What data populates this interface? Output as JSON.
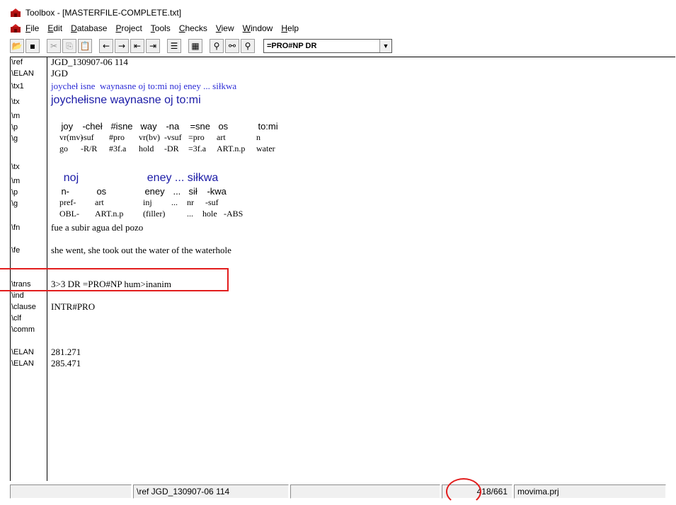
{
  "window": {
    "title": "Toolbox - [MASTERFILE-COMPLETE.txt]",
    "icon": "toolbox-app-icon"
  },
  "menu": [
    "File",
    "Edit",
    "Database",
    "Project",
    "Tools",
    "Checks",
    "View",
    "Window",
    "Help"
  ],
  "toolbar": {
    "buttons": [
      "open-icon",
      "save-icon",
      "cut-icon",
      "copy-icon",
      "paste-icon",
      "left-arrow-icon",
      "right-arrow-icon",
      "first-record-icon",
      "last-record-icon",
      "filter-icon",
      "browse-icon",
      "search-icon",
      "find-icon",
      "find-next-icon"
    ],
    "filter_value": "=PRO#NP DR"
  },
  "record": {
    "ref": {
      "marker": "\\ref",
      "value": "JGD_130907-06 114"
    },
    "elan1": {
      "marker": "\\ELAN",
      "value": "JGD"
    },
    "tx1": {
      "marker": "\\tx1",
      "value": "joycheł isne  waynasne oj to:mi noj eney ... siłkwa"
    },
    "block1": {
      "tx": {
        "marker": "\\tx",
        "value": "joychełisne waynasne oj to:mi"
      },
      "m": {
        "marker": "\\m",
        "cells": [
          "joy",
          "-cheł",
          "#isne",
          "way",
          "-na",
          "=sne",
          "os",
          "to:mi"
        ]
      },
      "p": {
        "marker": "\\p",
        "cells": [
          "vr(mv)",
          "-suf",
          "#pro",
          "vr(bv)",
          "-vsuf",
          "=pro",
          "art",
          "n"
        ]
      },
      "g": {
        "marker": "\\g",
        "cells": [
          "go",
          "-R/R",
          "#3f.a",
          "hold",
          "-DR",
          "=3f.a",
          "ART.n.p",
          "water"
        ]
      }
    },
    "block2": {
      "tx": {
        "marker": "\\tx",
        "cells": [
          "noj",
          "eney ... siłkwa"
        ]
      },
      "m": {
        "marker": "\\m",
        "cells": [
          "n-",
          "os",
          "eney",
          "...",
          "sił",
          "-kwa"
        ]
      },
      "p": {
        "marker": "\\p",
        "cells": [
          "pref-",
          "art",
          "inj",
          "...",
          "nr",
          "-suf"
        ]
      },
      "g": {
        "marker": "\\g",
        "cells": [
          "OBL-",
          "ART.n.p",
          "(filler)",
          "...",
          "hole",
          "-ABS"
        ]
      }
    },
    "fn": {
      "marker": "\\fn",
      "value": "fue a subir agua del pozo"
    },
    "fe": {
      "marker": "\\fe",
      "value": "she went, she took out the water of the waterhole"
    },
    "trans": {
      "marker": "\\trans",
      "value": "3>3 DR =PRO#NP hum>inanim"
    },
    "ind": {
      "marker": "\\ind",
      "value": ""
    },
    "clause": {
      "marker": "\\clause",
      "value": "INTR#PRO"
    },
    "clf": {
      "marker": "\\clf",
      "value": ""
    },
    "comm": {
      "marker": "\\comm",
      "value": ""
    },
    "elan2": {
      "marker": "\\ELAN",
      "value": "281.271"
    },
    "elan3": {
      "marker": "\\ELAN",
      "value": "285.471"
    }
  },
  "status": {
    "ref": "\\ref  JGD_130907-06 114",
    "position": "418/661",
    "project": "movima.prj"
  },
  "colors": {
    "highlight": "#e21d1d",
    "text_blue": "#2b2bd6"
  }
}
